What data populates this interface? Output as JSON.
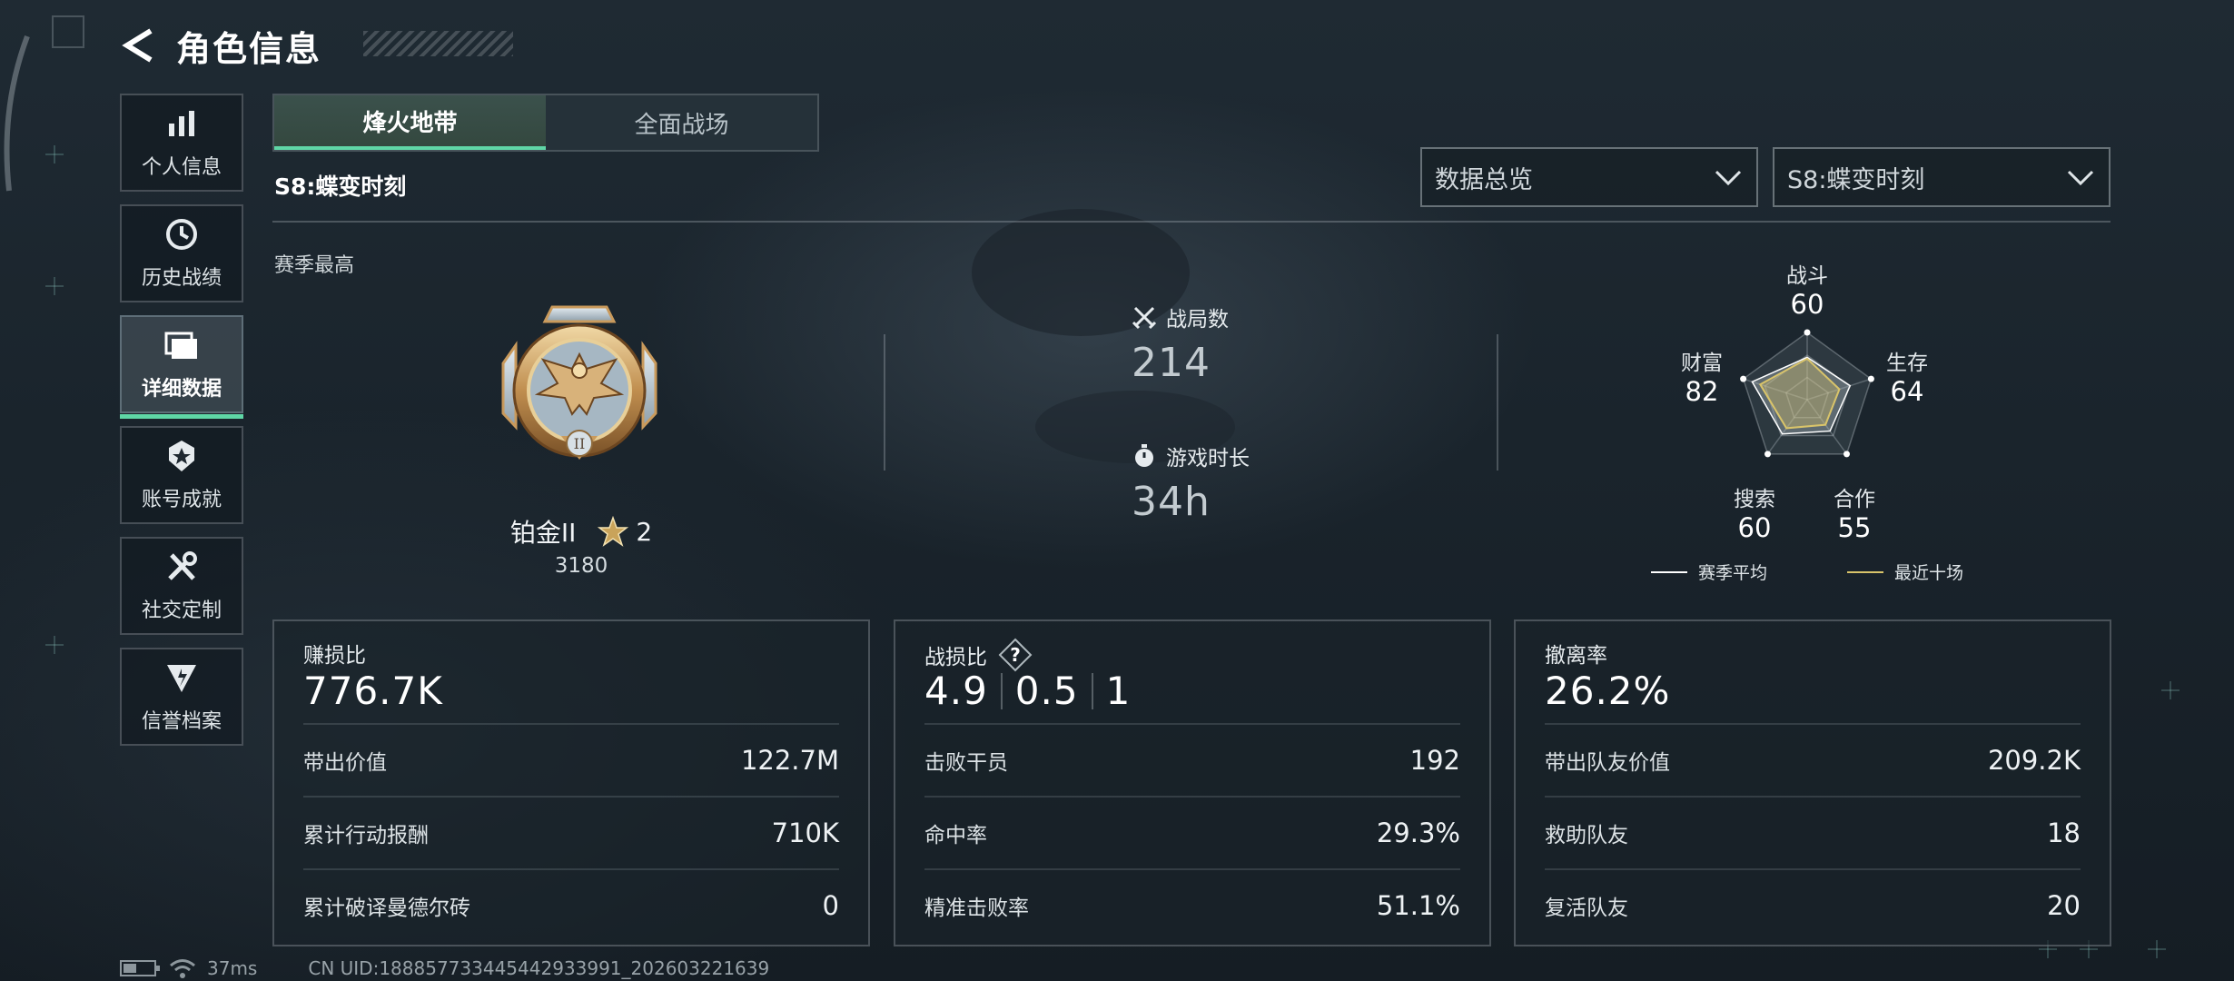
{
  "header": {
    "title": "角色信息"
  },
  "sidebar": {
    "items": [
      {
        "label": "个人信息",
        "icon": "bar-chart-icon"
      },
      {
        "label": "历史战绩",
        "icon": "history-icon"
      },
      {
        "label": "详细数据",
        "icon": "folder-icon",
        "active": true
      },
      {
        "label": "账号成就",
        "icon": "achievement-icon"
      },
      {
        "label": "社交定制",
        "icon": "tools-icon"
      },
      {
        "label": "信誉档案",
        "icon": "credit-icon"
      }
    ]
  },
  "tabs": [
    {
      "label": "烽火地带",
      "active": true
    },
    {
      "label": "全面战场",
      "active": false
    }
  ],
  "season": {
    "name": "S8:蝶变时刻"
  },
  "dropdowns": {
    "view": {
      "selected": "数据总览"
    },
    "season": {
      "selected": "S8:蝶变时刻"
    }
  },
  "season_best": {
    "label": "赛季最高",
    "rank_name": "铂金II",
    "stars": "2",
    "score": "3180"
  },
  "stats": {
    "matches": {
      "label": "战局数",
      "value": "214"
    },
    "playtime": {
      "label": "游戏时长",
      "value": "34h"
    }
  },
  "radar": {
    "labels": {
      "combat": "战斗",
      "survival": "生存",
      "cooperation": "合作",
      "search": "搜索",
      "wealth": "财富"
    },
    "values": {
      "combat": "60",
      "survival": "64",
      "cooperation": "55",
      "search": "60",
      "wealth": "82"
    },
    "legend": {
      "season_avg": "赛季平均",
      "recent_ten": "最近十场"
    },
    "season_avg_values": {
      "combat": 60,
      "survival": 64,
      "cooperation": 55,
      "search": 60,
      "wealth": 82
    },
    "recent_ten_values": {
      "combat": 58,
      "survival": 48,
      "cooperation": 44,
      "search": 50,
      "wealth": 70
    },
    "colors": {
      "season_avg": "#ffffff",
      "recent_ten": "#d9c46a"
    }
  },
  "cards": {
    "profit": {
      "title": "赚损比",
      "value": "776.7K",
      "rows": [
        {
          "label": "带出价值",
          "value": "122.7M"
        },
        {
          "label": "累计行动报酬",
          "value": "710K"
        },
        {
          "label": "累计破译曼德尔砖",
          "value": "0"
        }
      ]
    },
    "kd": {
      "title": "战损比",
      "help": "?",
      "ratios": [
        "4.9",
        "0.5",
        "1"
      ],
      "rows": [
        {
          "label": "击败干员",
          "value": "192"
        },
        {
          "label": "命中率",
          "value": "29.3%"
        },
        {
          "label": "精准击败率",
          "value": "51.1%"
        }
      ]
    },
    "extract": {
      "title": "撤离率",
      "value": "26.2%",
      "rows": [
        {
          "label": "带出队友价值",
          "value": "209.2K"
        },
        {
          "label": "救助队友",
          "value": "18"
        },
        {
          "label": "复活队友",
          "value": "20"
        }
      ]
    }
  },
  "footer": {
    "ping": "37ms",
    "uid": "CN UID:1888577334454429339​91_202603221639"
  },
  "colors": {
    "accent": "#5fd6a6",
    "gold": "#d9c46a"
  }
}
